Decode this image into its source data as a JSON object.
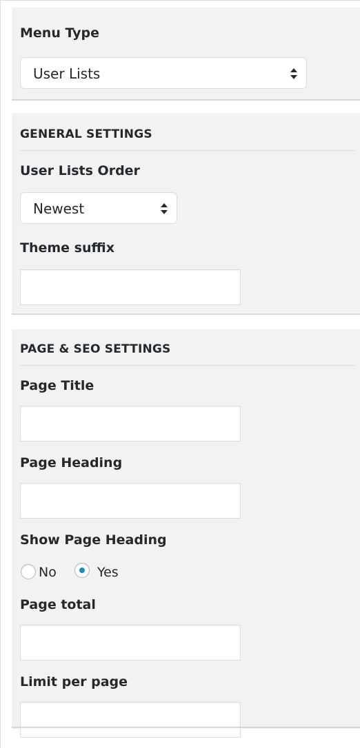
{
  "menu_type": {
    "label": "Menu Type",
    "selected": "User Lists"
  },
  "general_settings": {
    "title": "GENERAL SETTINGS",
    "order_label": "User Lists Order",
    "order_selected": "Newest",
    "theme_suffix_label": "Theme suffix",
    "theme_suffix_value": ""
  },
  "page_seo_settings": {
    "title": "PAGE & SEO SETTINGS",
    "page_title_label": "Page Title",
    "page_title_value": "",
    "page_heading_label": "Page Heading",
    "page_heading_value": "",
    "show_page_heading_label": "Show Page Heading",
    "radio_no_label": "No",
    "radio_yes_label": "Yes",
    "show_page_heading_selected": "Yes",
    "page_total_label": "Page total",
    "page_total_value": "",
    "limit_per_page_label": "Limit per page",
    "limit_per_page_value": ""
  },
  "icons": {
    "select_arrows": "up-down-arrows-icon"
  },
  "colors": {
    "panel_bg": "#f2f2f2",
    "radio_checked": "#1e8cbe",
    "text": "#23282d"
  }
}
